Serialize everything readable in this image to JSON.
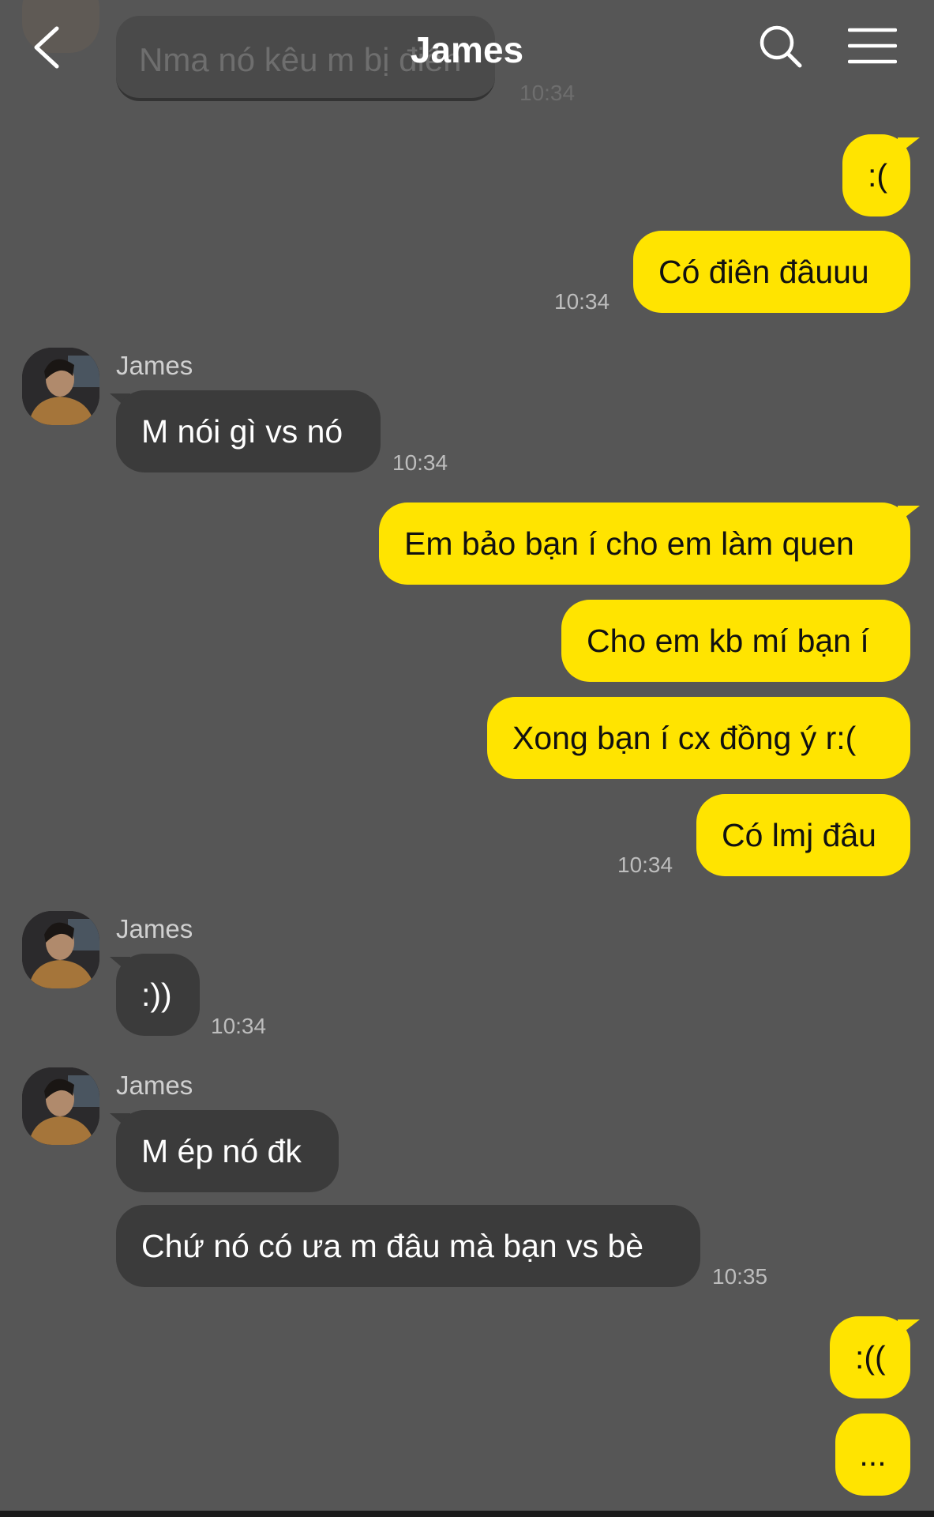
{
  "header": {
    "title": "James",
    "back_icon": "chevron-left-icon",
    "search_icon": "search-icon",
    "menu_icon": "hamburger-menu-icon"
  },
  "previous": {
    "text": "Nma nó kêu m bị điên",
    "time": "10:34"
  },
  "colors": {
    "background": "#565656",
    "my_bubble": "#ffe400",
    "their_bubble": "#3b3b3b",
    "timestamp": "#bdbdbd"
  },
  "messages": [
    {
      "from": "me",
      "text": ":("
    },
    {
      "from": "me",
      "text": "Có điên đâuuu",
      "time": "10:34"
    },
    {
      "from": "them",
      "sender": "James",
      "text": "M nói gì vs nó",
      "time": "10:34"
    },
    {
      "from": "me",
      "text": "Em bảo bạn í cho em làm quen"
    },
    {
      "from": "me",
      "text": "Cho em kb mí bạn í"
    },
    {
      "from": "me",
      "text": "Xong bạn í cx đồng ý r:("
    },
    {
      "from": "me",
      "text": "Có lmj đâu",
      "time": "10:34"
    },
    {
      "from": "them",
      "sender": "James",
      "text": ":))",
      "time": "10:34"
    },
    {
      "from": "them",
      "sender": "James",
      "text": "M ép nó đk"
    },
    {
      "from": "them",
      "text": "Chứ nó có ưa m đâu mà bạn vs bè",
      "time": "10:35"
    },
    {
      "from": "me",
      "text": ":(("
    },
    {
      "from": "me",
      "text": "..."
    }
  ]
}
